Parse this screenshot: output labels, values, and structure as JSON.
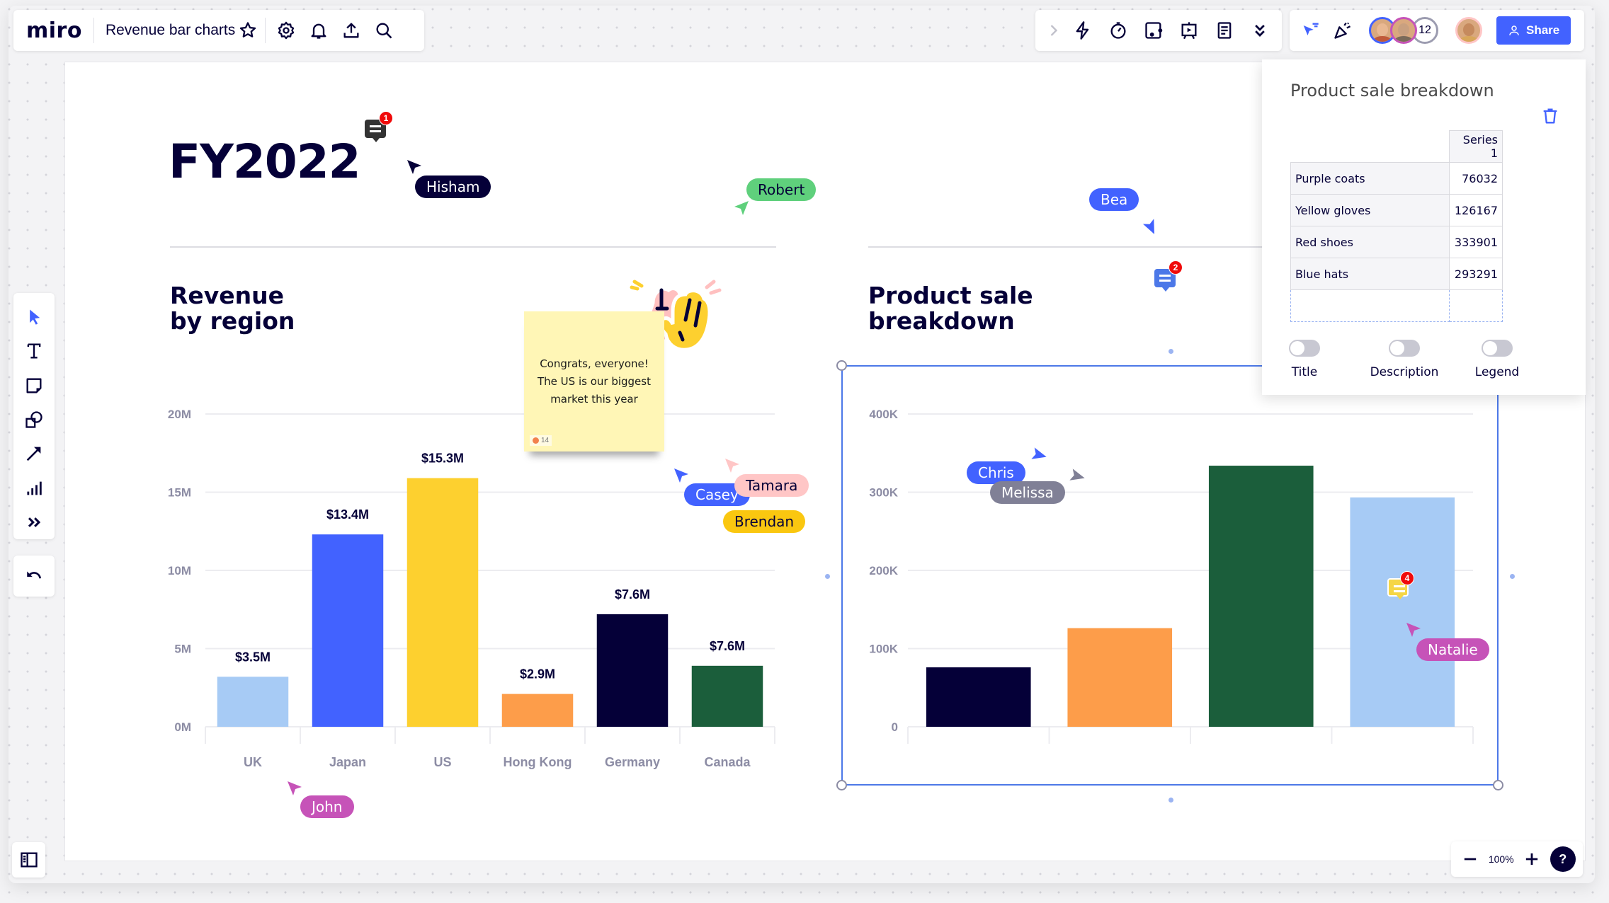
{
  "app": {
    "logo": "miro",
    "board_title": "Revenue bar charts",
    "zoom_level": "100%",
    "collaborator_count": "12",
    "share_label": "Share",
    "help_label": "?"
  },
  "topbar_left_icons": [
    "star-icon",
    "settings-gear-icon",
    "notification-bell-icon",
    "upload-export-icon",
    "search-icon"
  ],
  "topbar_mid_icons": [
    "chevron-right-icon",
    "lightning-icon",
    "timer-icon",
    "card-embed-icon",
    "presentation-icon",
    "notes-icon",
    "double-chevron-down-icon"
  ],
  "topbar_right_icons": [
    "cursor-filter-icon",
    "celebrate-icon"
  ],
  "left_tools": [
    "select-tool",
    "text-tool",
    "sticky-note-tool",
    "shapes-tool",
    "arrow-tool",
    "chart-tool",
    "more-tools"
  ],
  "canvas": {
    "title": "FY2022",
    "left_section_title": "Revenue\nby region",
    "right_section_title": "Product sale\nbreakdown",
    "sticky_note": {
      "text": "Congrats, everyone! The US is our biggest market this year",
      "reaction_count": "14",
      "color": "#fff6b6"
    },
    "comments": [
      {
        "id": "comment-1",
        "count": "1",
        "color": "#333333"
      },
      {
        "id": "comment-2",
        "count": "2",
        "color": "#4c78e8"
      },
      {
        "id": "comment-3",
        "count": "4",
        "color": "#f5d646"
      }
    ],
    "cursors": [
      {
        "name": "Hisham",
        "color": "#050038",
        "text_color": "#ffffff"
      },
      {
        "name": "Robert",
        "color": "#5fd07c",
        "text_color": "#050038"
      },
      {
        "name": "Bea",
        "color": "#4262ff",
        "text_color": "#ffffff"
      },
      {
        "name": "Casey",
        "color": "#4262ff",
        "text_color": "#ffffff"
      },
      {
        "name": "Tamara",
        "color": "#ffc6c6",
        "text_color": "#050038"
      },
      {
        "name": "Brendan",
        "color": "#fac710",
        "text_color": "#050038"
      },
      {
        "name": "Chris",
        "color": "#4262ff",
        "text_color": "#ffffff"
      },
      {
        "name": "Melissa",
        "color": "#808096",
        "text_color": "#ffffff"
      },
      {
        "name": "Natalie",
        "color": "#c653b8",
        "text_color": "#ffffff"
      },
      {
        "name": "John",
        "color": "#c653b8",
        "text_color": "#ffffff"
      }
    ]
  },
  "side_panel": {
    "title": "Product sale breakdown",
    "series_header": "Series 1",
    "rows": [
      {
        "label": "Purple coats",
        "value": "76032"
      },
      {
        "label": "Yellow gloves",
        "value": "126167"
      },
      {
        "label": "Red shoes",
        "value": "333901"
      },
      {
        "label": "Blue hats",
        "value": "293291"
      }
    ],
    "toggles": [
      {
        "label": "Title",
        "on": false
      },
      {
        "label": "Description",
        "on": false
      },
      {
        "label": "Legend",
        "on": false
      }
    ]
  },
  "chart_data": [
    {
      "type": "bar",
      "title": "Revenue by region",
      "categories": [
        "UK",
        "Japan",
        "US",
        "Hong Kong",
        "Germany",
        "Canada"
      ],
      "values": [
        3.2,
        12.3,
        15.9,
        2.1,
        7.2,
        3.9
      ],
      "data_labels": [
        "$3.5M",
        "$13.4M",
        "$15.3M",
        "$2.9M",
        "$7.6M",
        "$7.6M"
      ],
      "colors": [
        "#a7cbf5",
        "#4262ff",
        "#fdd02f",
        "#fd9d4a",
        "#050038",
        "#1b5e3b"
      ],
      "yticks": [
        "0M",
        "5M",
        "10M",
        "15M",
        "20M"
      ],
      "ytick_values": [
        0,
        5,
        10,
        15,
        20
      ],
      "ylim": [
        0,
        20
      ],
      "xlabel": "",
      "ylabel": "",
      "grid": true
    },
    {
      "type": "bar",
      "title": "Product sale breakdown",
      "categories": [
        "Purple coats",
        "Yellow gloves",
        "Red shoes",
        "Blue hats"
      ],
      "values": [
        76032,
        126167,
        333901,
        293291
      ],
      "colors": [
        "#050038",
        "#fd9d4a",
        "#1b5e3b",
        "#a7cbf5"
      ],
      "yticks": [
        "0",
        "100K",
        "200K",
        "300K",
        "400K"
      ],
      "ytick_values": [
        0,
        100000,
        200000,
        300000,
        400000
      ],
      "ylim": [
        0,
        400000
      ],
      "xlabel": "",
      "ylabel": "",
      "grid": true
    }
  ]
}
